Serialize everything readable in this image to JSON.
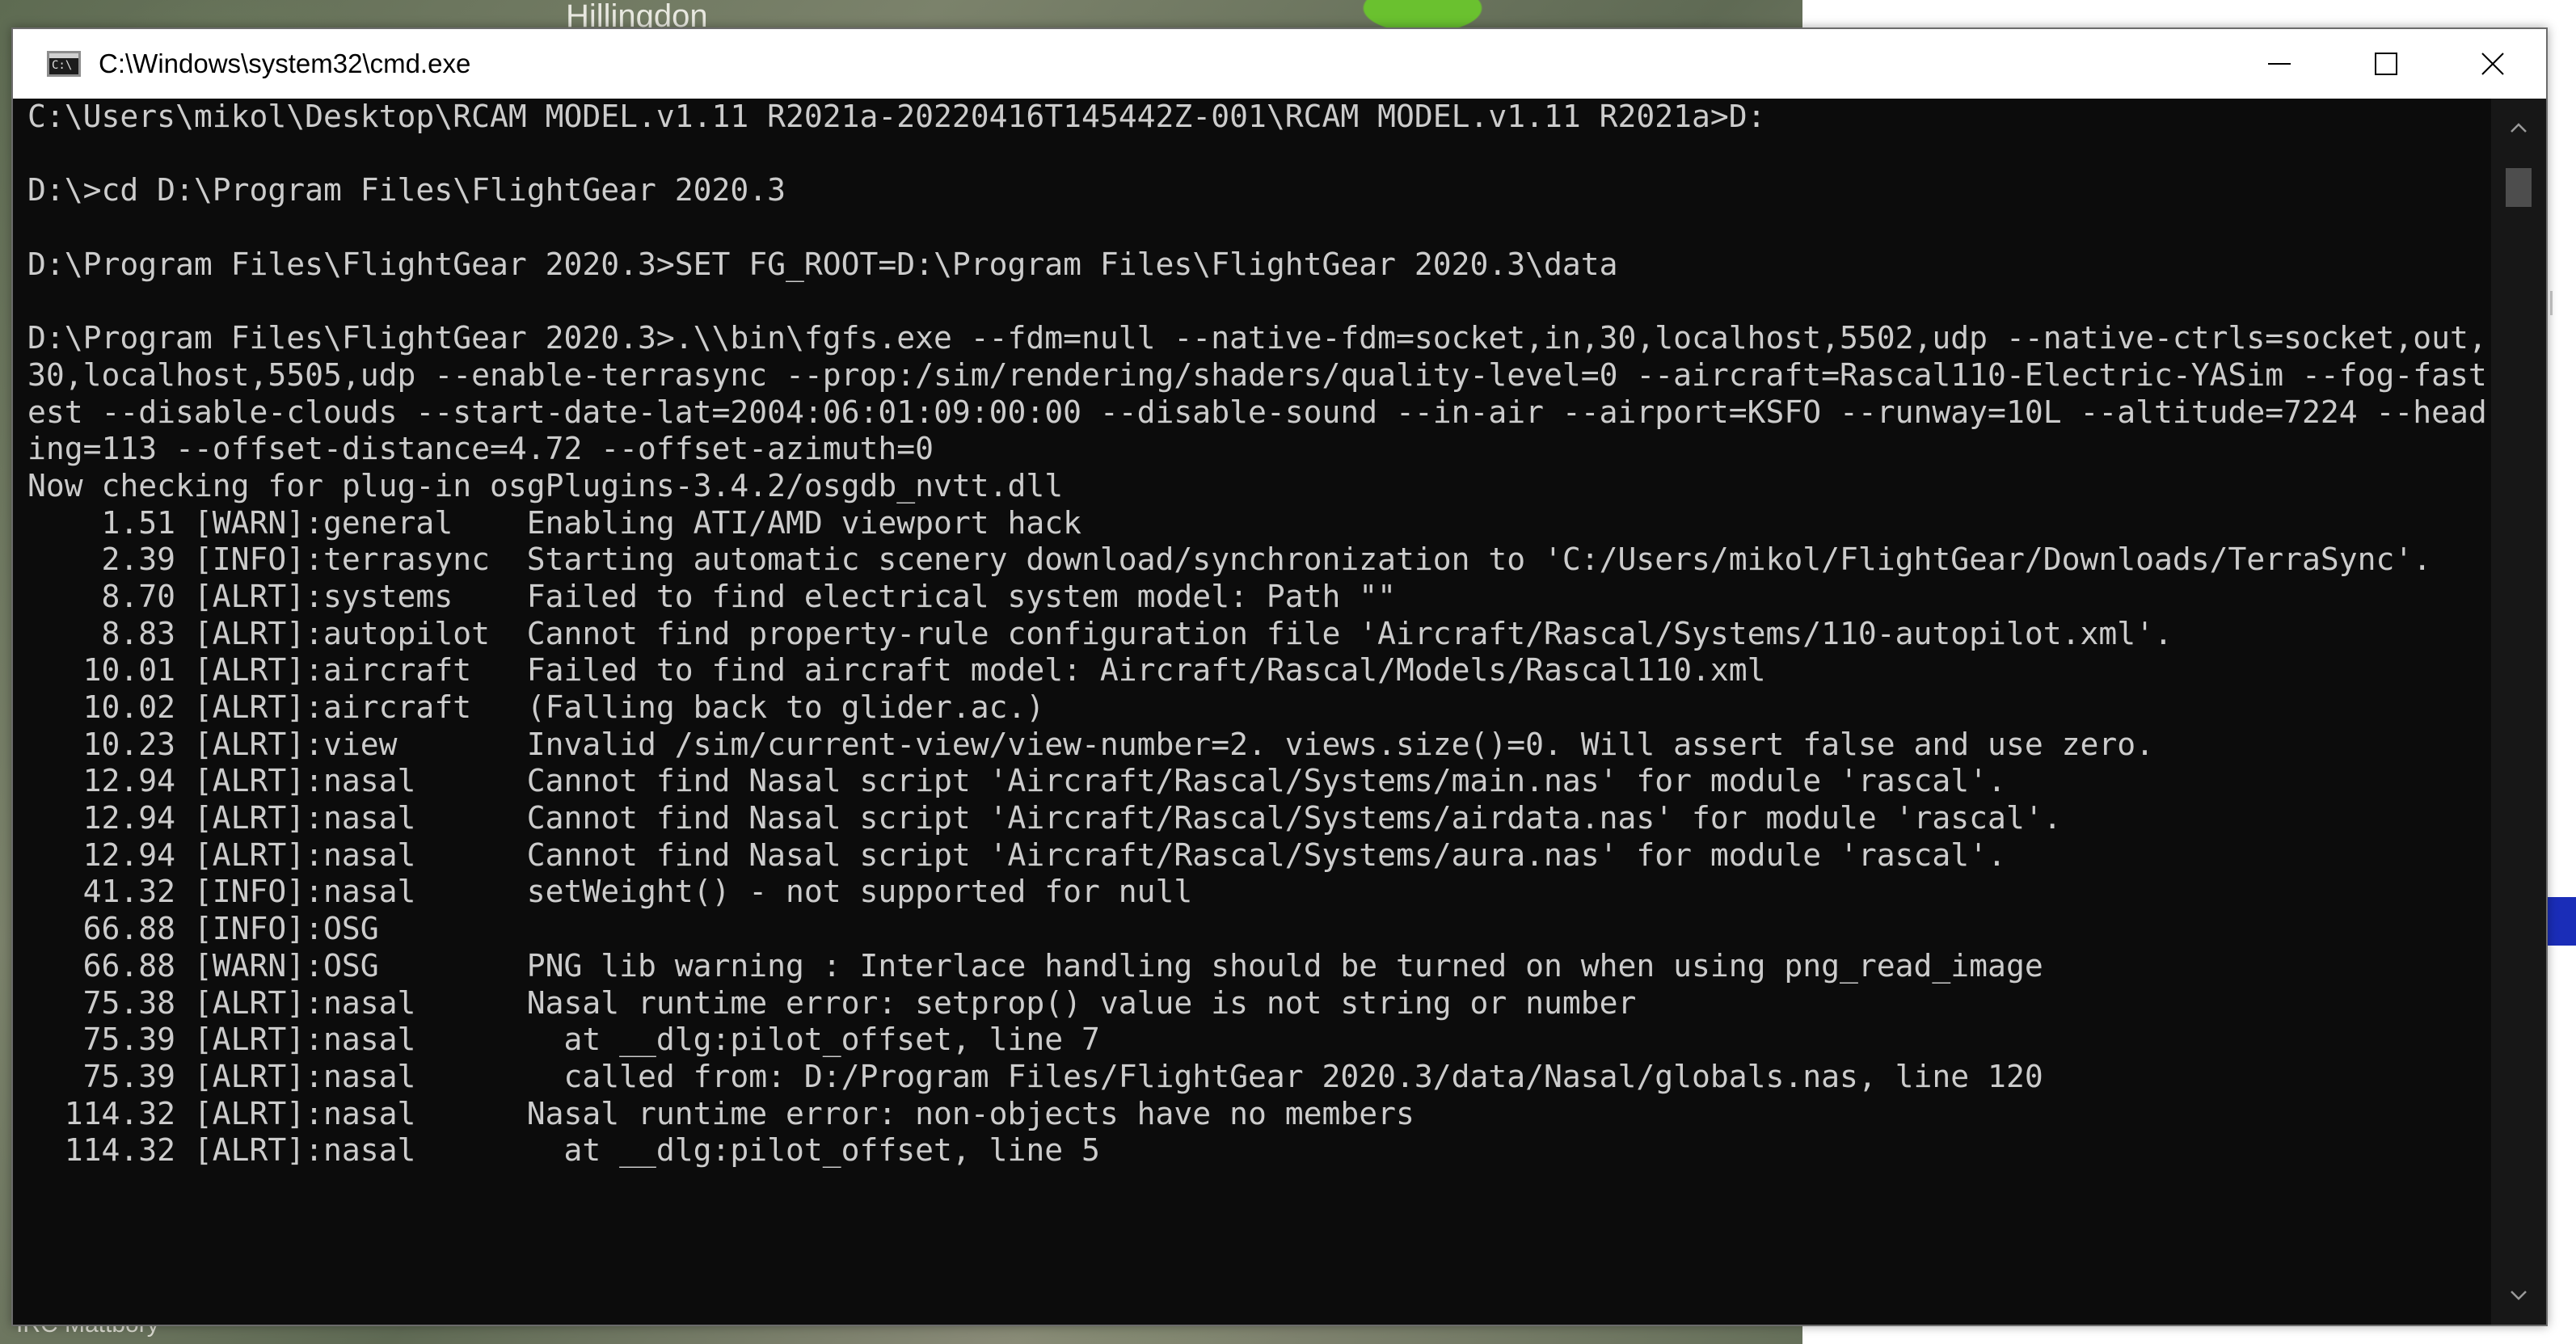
{
  "background": {
    "map_label_top": "Hillingdon",
    "map_label_bottom": "IRC Mattbory"
  },
  "window": {
    "title": "C:\\Windows\\system32\\cmd.exe",
    "app_icon": "cmd-icon",
    "controls": {
      "minimize": "minimize-icon",
      "maximize": "maximize-icon",
      "close": "close-icon"
    }
  },
  "console": {
    "lines": [
      "C:\\Users\\mikol\\Desktop\\RCAM MODEL.v1.11 R2021a-20220416T145442Z-001\\RCAM MODEL.v1.11 R2021a>D:",
      "",
      "D:\\>cd D:\\Program Files\\FlightGear 2020.3",
      "",
      "D:\\Program Files\\FlightGear 2020.3>SET FG_ROOT=D:\\Program Files\\FlightGear 2020.3\\data",
      "",
      "D:\\Program Files\\FlightGear 2020.3>.\\\\bin\\fgfs.exe --fdm=null --native-fdm=socket,in,30,localhost,5502,udp --native-ctrls=socket,out,",
      "30,localhost,5505,udp --enable-terrasync --prop:/sim/rendering/shaders/quality-level=0 --aircraft=Rascal110-Electric-YASim --fog-fast",
      "est --disable-clouds --start-date-lat=2004:06:01:09:00:00 --disable-sound --in-air --airport=KSFO --runway=10L --altitude=7224 --head",
      "ing=113 --offset-distance=4.72 --offset-azimuth=0",
      "Now checking for plug-in osgPlugins-3.4.2/osgdb_nvtt.dll",
      "    1.51 [WARN]:general    Enabling ATI/AMD viewport hack",
      "    2.39 [INFO]:terrasync  Starting automatic scenery download/synchronization to 'C:/Users/mikol/FlightGear/Downloads/TerraSync'.",
      "    8.70 [ALRT]:systems    Failed to find electrical system model: Path \"\"",
      "    8.83 [ALRT]:autopilot  Cannot find property-rule configuration file 'Aircraft/Rascal/Systems/110-autopilot.xml'.",
      "   10.01 [ALRT]:aircraft   Failed to find aircraft model: Aircraft/Rascal/Models/Rascal110.xml",
      "   10.02 [ALRT]:aircraft   (Falling back to glider.ac.)",
      "   10.23 [ALRT]:view       Invalid /sim/current-view/view-number=2. views.size()=0. Will assert false and use zero.",
      "   12.94 [ALRT]:nasal      Cannot find Nasal script 'Aircraft/Rascal/Systems/main.nas' for module 'rascal'.",
      "   12.94 [ALRT]:nasal      Cannot find Nasal script 'Aircraft/Rascal/Systems/airdata.nas' for module 'rascal'.",
      "   12.94 [ALRT]:nasal      Cannot find Nasal script 'Aircraft/Rascal/Systems/aura.nas' for module 'rascal'.",
      "   41.32 [INFO]:nasal      setWeight() - not supported for null",
      "   66.88 [INFO]:OSG",
      "   66.88 [WARN]:OSG        PNG lib warning : Interlace handling should be turned on when using png_read_image",
      "   75.38 [ALRT]:nasal      Nasal runtime error: setprop() value is not string or number",
      "   75.39 [ALRT]:nasal        at __dlg:pilot_offset, line 7",
      "   75.39 [ALRT]:nasal        called from: D:/Program Files/FlightGear 2020.3/data/Nasal/globals.nas, line 120",
      "  114.32 [ALRT]:nasal      Nasal runtime error: non-objects have no members",
      "  114.32 [ALRT]:nasal        at __dlg:pilot_offset, line 5"
    ]
  },
  "scrollbar": {
    "up_icon": "scroll-up-arrow-icon",
    "down_icon": "scroll-down-arrow-icon"
  }
}
